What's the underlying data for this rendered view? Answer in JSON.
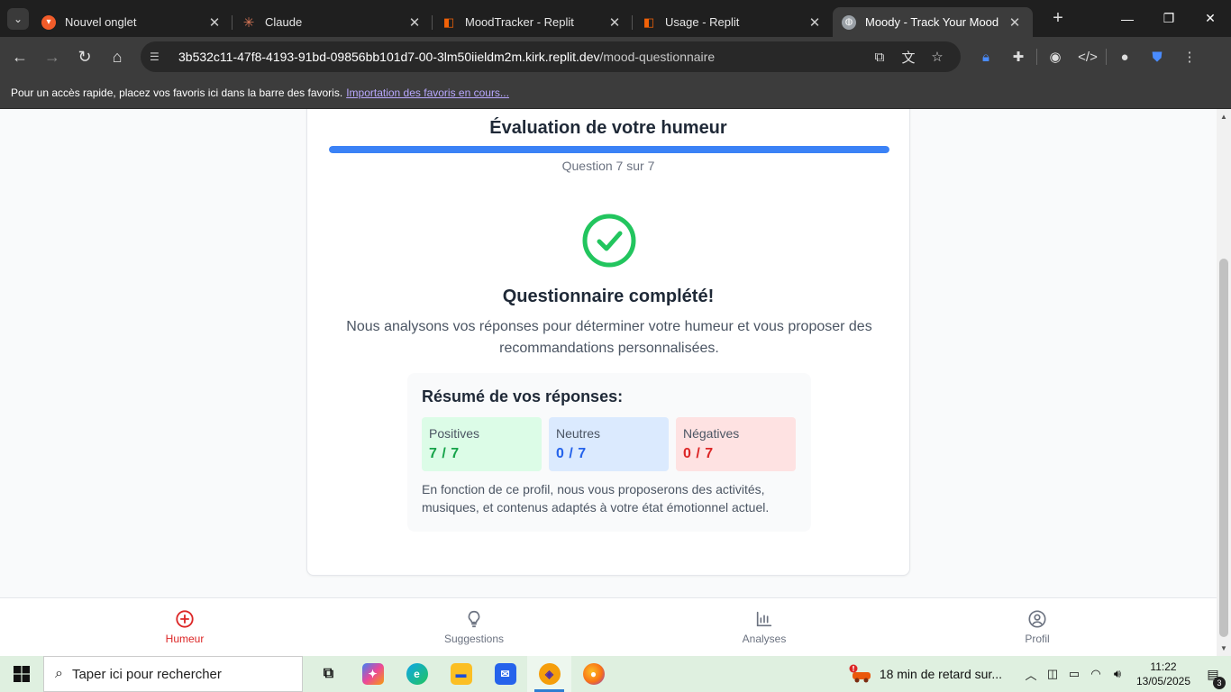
{
  "browser": {
    "tabs": [
      {
        "title": "Nouvel onglet",
        "icon": "brave-icon",
        "color": "#f25c2a",
        "active": false
      },
      {
        "title": "Claude",
        "icon": "claude-icon",
        "color": "#d97757",
        "active": false
      },
      {
        "title": "MoodTracker - Replit",
        "icon": "replit-icon",
        "color": "#f26207",
        "active": false
      },
      {
        "title": "Usage - Replit",
        "icon": "replit-icon",
        "color": "#f26207",
        "active": false
      },
      {
        "title": "Moody - Track Your Mood",
        "icon": "globe-icon",
        "color": "#9aa0a6",
        "active": true
      }
    ],
    "url_host": "3b532c11-47f8-4193-91bd-09856bb101d7-00-3lm50iieldm2m.kirk.replit.dev",
    "url_path": "/mood-questionnaire",
    "bookmarks_text": "Pour un accès rapide, placez vos favoris ici dans la barre des favoris.",
    "bookmarks_link": "Importation des favoris en cours..."
  },
  "page": {
    "title": "Évaluation de votre humeur",
    "progress_fraction": 1.0,
    "question_counter": "Question 7 sur 7",
    "accent_color": "#3b82f6",
    "success_color": "#22c55e",
    "completed_title": "Questionnaire complété!",
    "completed_text": "Nous analysons vos réponses pour déterminer votre humeur et vous proposer des recommandations personnalisées.",
    "summary": {
      "title": "Résumé de vos réponses:",
      "positive_label": "Positives",
      "positive_value": "7 / 7",
      "neutral_label": "Neutres",
      "neutral_value": "0 / 7",
      "negative_label": "Négatives",
      "negative_value": "0 / 7",
      "note": "En fonction de ce profil, nous vous proposerons des activités, musiques, et contenus adaptés à votre état émotionnel actuel."
    }
  },
  "bottom_nav": [
    {
      "label": "Humeur",
      "icon": "plus-circle-icon",
      "active": true
    },
    {
      "label": "Suggestions",
      "icon": "lightbulb-icon",
      "active": false
    },
    {
      "label": "Analyses",
      "icon": "bar-chart-icon",
      "active": false
    },
    {
      "label": "Profil",
      "icon": "user-circle-icon",
      "active": false
    }
  ],
  "taskbar": {
    "search_placeholder": "Taper ici pour rechercher",
    "weather_text": "18 min de retard sur...",
    "time": "11:22",
    "date": "13/05/2025",
    "notification_count": "3"
  }
}
